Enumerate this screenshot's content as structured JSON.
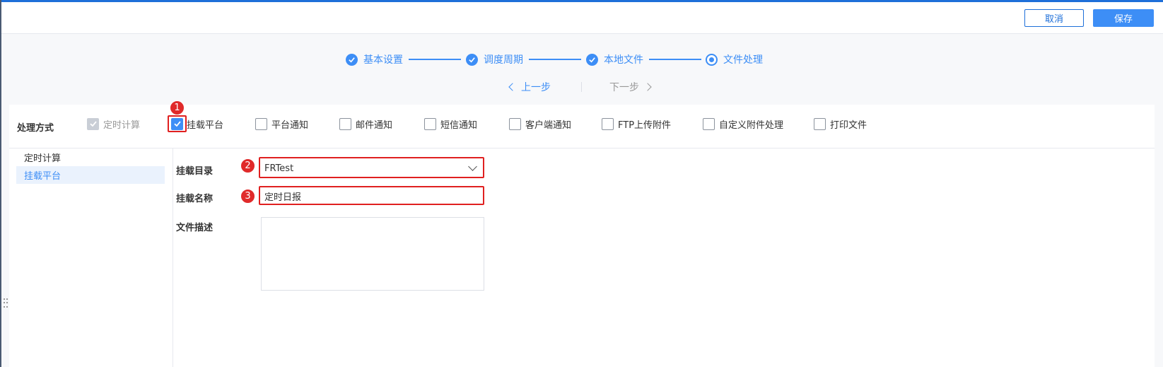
{
  "header": {
    "cancel_label": "取消",
    "save_label": "保存"
  },
  "steps": [
    {
      "label": "基本设置",
      "state": "done"
    },
    {
      "label": "调度周期",
      "state": "done"
    },
    {
      "label": "本地文件",
      "state": "done"
    },
    {
      "label": "文件处理",
      "state": "current"
    }
  ],
  "nav": {
    "prev_label": "上一步",
    "next_label": "下一步"
  },
  "method": {
    "title": "处理方式",
    "options": [
      {
        "label": "定时计算",
        "checked": true,
        "disabled": true
      },
      {
        "label": "挂载平台",
        "checked": true,
        "disabled": false
      },
      {
        "label": "平台通知",
        "checked": false
      },
      {
        "label": "邮件通知",
        "checked": false
      },
      {
        "label": "短信通知",
        "checked": false
      },
      {
        "label": "客户端通知",
        "checked": false
      },
      {
        "label": "FTP上传附件",
        "checked": false
      },
      {
        "label": "自定义附件处理",
        "checked": false
      },
      {
        "label": "打印文件",
        "checked": false
      }
    ]
  },
  "sidebar": {
    "items": [
      {
        "label": "定时计算"
      },
      {
        "label": "挂载平台"
      }
    ]
  },
  "form": {
    "mount_dir_label": "挂载目录",
    "mount_dir_value": "FRTest",
    "mount_name_label": "挂载名称",
    "mount_name_value": "定时日报",
    "file_desc_label": "文件描述",
    "file_desc_value": ""
  },
  "annotations": {
    "badge1": "1",
    "badge2": "2",
    "badge3": "3"
  },
  "colors": {
    "accent": "#3d8ef6",
    "highlight": "#e02020",
    "top_bar": "#1e6fd9"
  }
}
